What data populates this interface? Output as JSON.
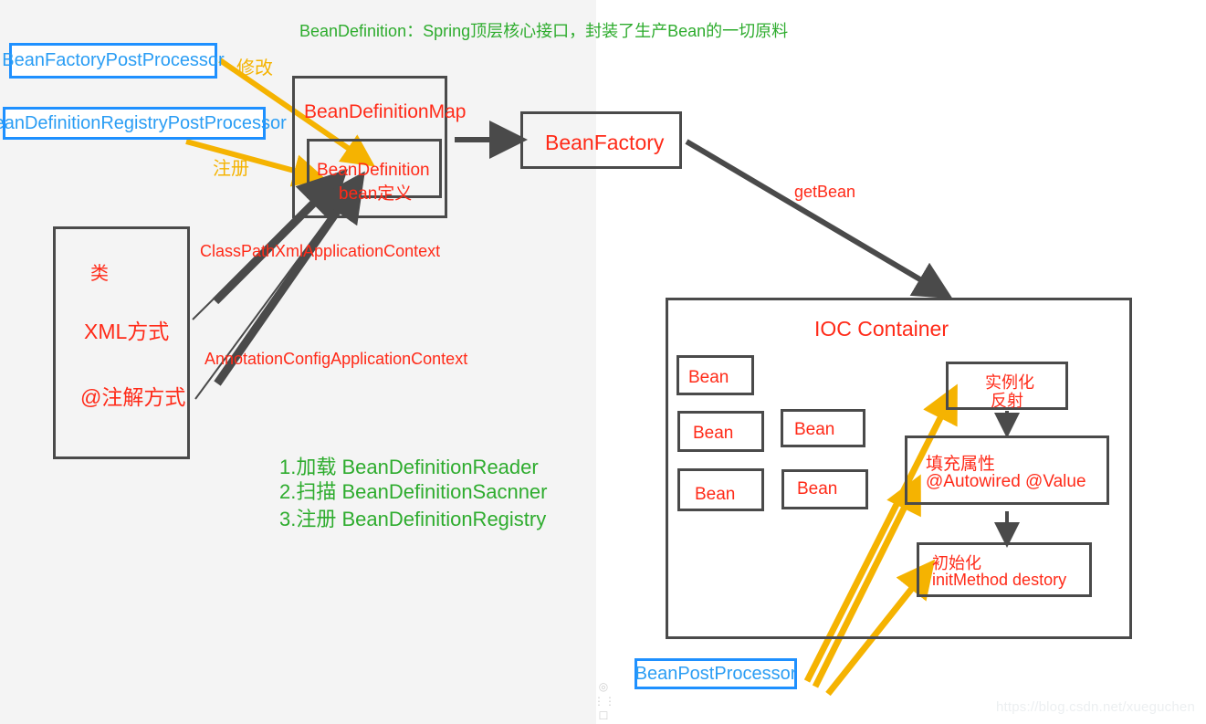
{
  "page": {
    "title_note": "BeanDefinition：Spring顶层核心接口，封装了生产Bean的一切原料",
    "watermark": "https://blog.csdn.net/xueguchen",
    "colors": {
      "red": "#ff2a18",
      "green": "#2eac2e",
      "blue": "#2a9df4",
      "blue_border": "#1e90ff",
      "yellow": "#f5b301",
      "grey_stroke": "#4a4a4a",
      "bg_left": "#f4f4f4",
      "bg_right": "#ffffff"
    }
  },
  "left": {
    "bean_factory_post_processor": "BeanFactoryPostProcessor",
    "bean_definition_registry_post_processor": "BeanDefinitionRegistryPostProcessor",
    "edge_modify_label": "修改",
    "edge_register_label": "注册",
    "source_box": {
      "line1": "类",
      "line2": "XML方式",
      "line3": "@注解方式"
    },
    "edge_classpath_label": "ClassPathXmlApplicationContext",
    "edge_annotation_label": "AnnotationConfigApplicationContext",
    "steps": [
      "1.加载 BeanDefinitionReader",
      "2.扫描 BeanDefinitionSacnner",
      "3.注册 BeanDefinitionRegistry"
    ]
  },
  "middle": {
    "bean_definition_map": "BeanDefinitionMap",
    "bean_definition_line1": "BeanDefinition",
    "bean_definition_line2": "bean定义"
  },
  "right": {
    "bean_factory": "BeanFactory",
    "get_bean_label": "getBean",
    "ioc_container_title": "IOC Container",
    "beans": [
      "Bean",
      "Bean",
      "Bean",
      "Bean",
      "Bean"
    ],
    "lifecycle": [
      {
        "line1": "实例化",
        "line2": "反射"
      },
      {
        "line1": "填充属性",
        "line2": "@Autowired  @Value"
      },
      {
        "line1": "初始化",
        "line2": "initMethod destory"
      }
    ],
    "bean_post_processor": "BeanPostProcessor"
  },
  "toolbar_icons": [
    "target-icon",
    "fit-icon",
    "frame-icon"
  ]
}
